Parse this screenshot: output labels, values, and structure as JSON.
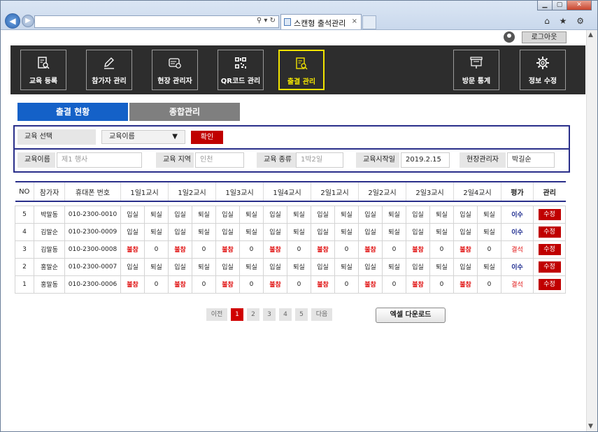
{
  "browser": {
    "tab_title": "스캔형 출석관리",
    "address_controls": "⚲ ▾ ↻",
    "tab_close": "×",
    "right_icons": "⌂ ★ ⚙",
    "window_controls": [
      "▁",
      "▢",
      "✕"
    ]
  },
  "header": {
    "logout_label": "로그아웃"
  },
  "menu": {
    "items": [
      {
        "label": "교육 등록",
        "icon": "document-search-icon"
      },
      {
        "label": "참가자 관리",
        "icon": "pencil-icon"
      },
      {
        "label": "현장 관리자",
        "icon": "card-icon"
      },
      {
        "label": "QR코드 관리",
        "icon": "qr-code-icon"
      },
      {
        "label": "출결 관리",
        "icon": "document-search-icon"
      },
      {
        "label": "방문 통계",
        "icon": "presentation-icon"
      },
      {
        "label": "정보 수정",
        "icon": "gear-icon"
      }
    ],
    "active_index": 4
  },
  "subtabs": {
    "status": "출결 현황",
    "overall": "종합관리"
  },
  "filter": {
    "course_select_label": "교육 선택",
    "course_select_value": "교육이름",
    "confirm_label": "확인",
    "fields": [
      {
        "label": "교육이름",
        "value": "제1 행사"
      },
      {
        "label": "교육 지역",
        "value": "인천"
      },
      {
        "label": "교육 종류",
        "value": "1박2일"
      },
      {
        "label": "교육시작일",
        "value": "2019.2.15"
      },
      {
        "label": "현장관리자",
        "value": "박길순"
      }
    ]
  },
  "table": {
    "headers": [
      "NO",
      "참가자",
      "휴대폰 번호",
      "1일1교시",
      "1일2교시",
      "1일3교시",
      "1일4교시",
      "2일1교시",
      "2일2교시",
      "2일3교시",
      "2일4교시",
      "평가",
      "관리"
    ],
    "rows": [
      {
        "no": "5",
        "name": "박말동",
        "phone": "010-2300-0010",
        "cells": [
          "입실",
          "퇴실",
          "입실",
          "퇴실",
          "입실",
          "퇴실",
          "입실",
          "퇴실",
          "입실",
          "퇴실",
          "입실",
          "퇴실",
          "입실",
          "퇴실",
          "입실",
          "퇴실"
        ],
        "eval": "이수",
        "action": "수정"
      },
      {
        "no": "4",
        "name": "김말순",
        "phone": "010-2300-0009",
        "cells": [
          "입실",
          "퇴실",
          "입실",
          "퇴실",
          "입실",
          "퇴실",
          "입실",
          "퇴실",
          "입실",
          "퇴실",
          "입실",
          "퇴실",
          "입실",
          "퇴실",
          "입실",
          "퇴실"
        ],
        "eval": "이수",
        "action": "수정"
      },
      {
        "no": "3",
        "name": "김말동",
        "phone": "010-2300-0008",
        "cells": [
          "불참",
          "0",
          "불참",
          "0",
          "불참",
          "0",
          "불참",
          "0",
          "불참",
          "0",
          "불참",
          "0",
          "불참",
          "0",
          "불참",
          "0"
        ],
        "eval": "결석",
        "action": "수정"
      },
      {
        "no": "2",
        "name": "홍말순",
        "phone": "010-2300-0007",
        "cells": [
          "입실",
          "퇴실",
          "입실",
          "퇴실",
          "입실",
          "퇴실",
          "입실",
          "퇴실",
          "입실",
          "퇴실",
          "입실",
          "퇴실",
          "입실",
          "퇴실",
          "입실",
          "퇴실"
        ],
        "eval": "이수",
        "action": "수정"
      },
      {
        "no": "1",
        "name": "홍말동",
        "phone": "010-2300-0006",
        "cells": [
          "불참",
          "0",
          "불참",
          "0",
          "불참",
          "0",
          "불참",
          "0",
          "불참",
          "0",
          "불참",
          "0",
          "불참",
          "0",
          "불참",
          "0"
        ],
        "eval": "결석",
        "action": "수정"
      }
    ]
  },
  "pagination": {
    "prev": "이전",
    "pages": [
      "1",
      "2",
      "3",
      "4",
      "5"
    ],
    "current": "1",
    "next": "다음"
  },
  "excel_label": "엑셀 다운로드",
  "colors": {
    "accent": "#1461c8",
    "danger": "#c00000",
    "active_menu": "#f2e400",
    "frame": "#2a2f8a"
  }
}
